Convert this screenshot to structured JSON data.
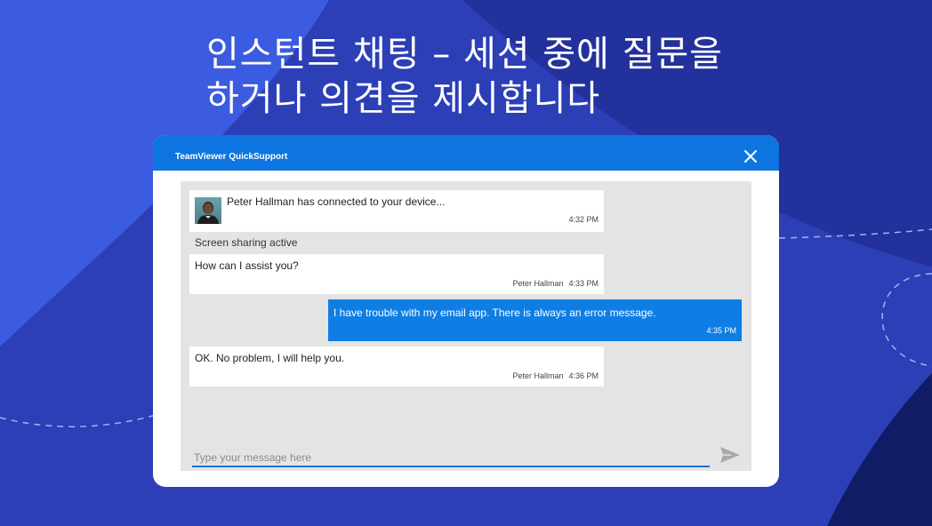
{
  "headline": {
    "line1": "인스턴트 채팅 – 세션 중에 질문을",
    "line2": "하거나 의견을 제시합니다"
  },
  "window": {
    "title": "TeamViewer QuickSupport",
    "close_icon": "close-icon"
  },
  "chat": {
    "messages": [
      {
        "text": "Peter Hallman has connected to your device...",
        "sender": "",
        "time": "4:32 PM",
        "direction": "incoming",
        "avatar": true
      },
      {
        "text": "How can I assist you?",
        "sender": "Peter Hallman",
        "time": "4:33 PM",
        "direction": "incoming"
      },
      {
        "text": "I have trouble with my email app. There is always an error message.",
        "sender": "",
        "time": "4:35 PM",
        "direction": "outgoing"
      },
      {
        "text": "OK. No problem, I will help you.",
        "sender": "Peter Hallman",
        "time": "4:36 PM",
        "direction": "incoming"
      }
    ],
    "system_message": "Screen sharing active",
    "input": {
      "value": "",
      "placeholder": "Type your message here"
    },
    "send_icon": "send-icon"
  },
  "colors": {
    "background": "#2c3fb6",
    "titlebar": "#0e75e0",
    "outgoing_bubble": "#0e7ee4",
    "chat_area": "#e4e4e4"
  }
}
